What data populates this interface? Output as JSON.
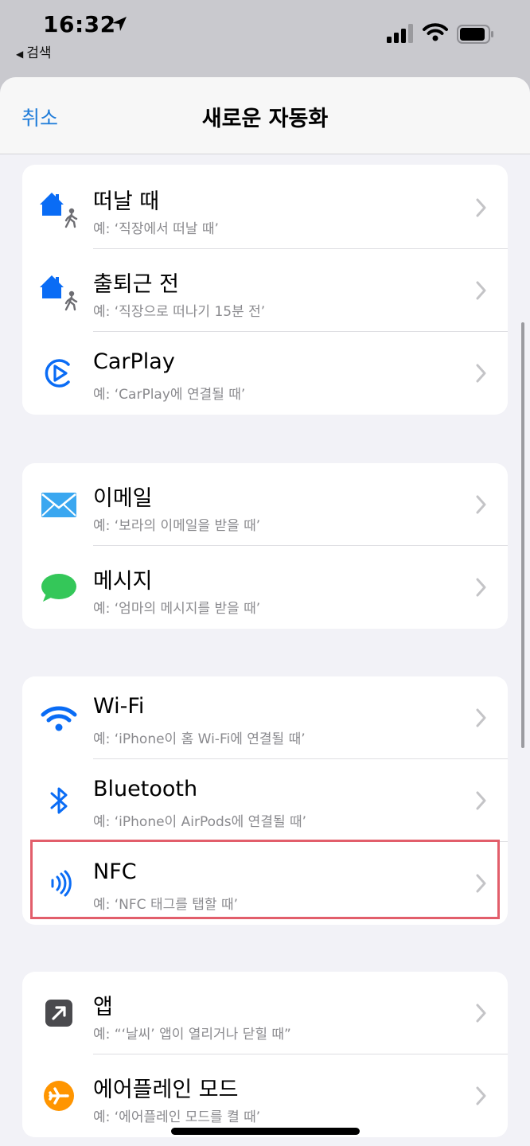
{
  "status_bar": {
    "time": "16:32",
    "back_label": "검색"
  },
  "nav": {
    "cancel_label": "취소",
    "title": "새로운 자동화"
  },
  "colors": {
    "accent": "#1f7cd9",
    "highlight": "#e25e6b",
    "subtitle": "#8a8a8e"
  },
  "groups": [
    {
      "items": [
        {
          "icon": "home-leave-icon",
          "title": "떠날 때",
          "subtitle": "예: ‘직장에서 떠날 때’"
        },
        {
          "icon": "home-commute-icon",
          "title": "출퇴근 전",
          "subtitle": "예: ‘직장으로 떠나기 15분 전’"
        },
        {
          "icon": "carplay-icon",
          "title": "CarPlay",
          "subtitle": "예: ‘CarPlay에 연결될 때’"
        }
      ]
    },
    {
      "items": [
        {
          "icon": "mail-icon",
          "title": "이메일",
          "subtitle": "예: ‘보라의 이메일을 받을 때’"
        },
        {
          "icon": "message-icon",
          "title": "메시지",
          "subtitle": "예: ‘엄마의 메시지를 받을 때’"
        }
      ]
    },
    {
      "items": [
        {
          "icon": "wifi-icon",
          "title": "Wi-Fi",
          "subtitle": "예: ‘iPhone이 홈 Wi-Fi에 연결될 때’"
        },
        {
          "icon": "bluetooth-icon",
          "title": "Bluetooth",
          "subtitle": "예: ‘iPhone이 AirPods에 연결될 때’"
        },
        {
          "icon": "nfc-icon",
          "title": "NFC",
          "subtitle": "예: ‘NFC 태그를 탭할 때’"
        }
      ]
    },
    {
      "items": [
        {
          "icon": "app-icon",
          "title": "앱",
          "subtitle": "예: “‘날씨’ 앱이 열리거나 닫힐 때”"
        },
        {
          "icon": "airplane-mode-icon",
          "title": "에어플레인 모드",
          "subtitle": "예: ‘에어플레인 모드를 켤 때’"
        }
      ]
    }
  ]
}
